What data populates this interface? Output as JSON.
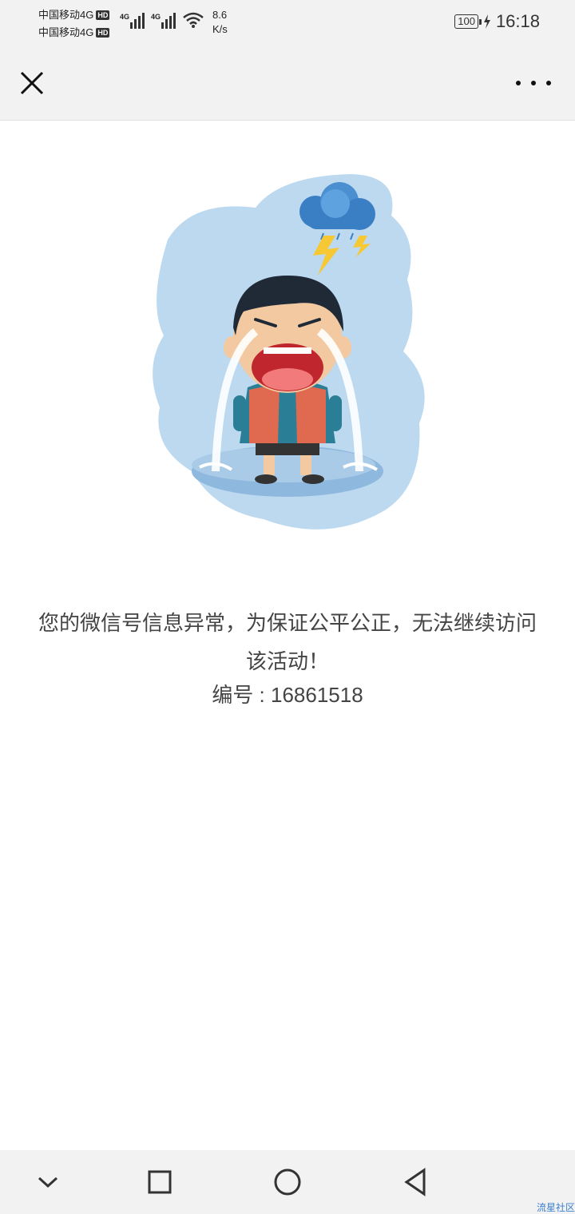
{
  "status_bar": {
    "carrier1": "中国移动4G",
    "carrier2": "中国移动4G",
    "hd_badge": "HD",
    "network1": "4G",
    "network2": "4G",
    "speed_value": "8.6",
    "speed_unit": "K/s",
    "battery": "100",
    "time": "16:18"
  },
  "header": {
    "close_icon": "close-icon",
    "more_icon": "more-dots-icon"
  },
  "main": {
    "illustration": "crying-boy-with-rain-cloud",
    "message": "您的微信号信息异常，为保证公平公正，无法继续访问该活动！",
    "code_label": "编号",
    "code_separator": " : ",
    "code_value": "16861518"
  },
  "nav_bar": {
    "items": [
      "chevron-down-icon",
      "square-icon",
      "circle-icon",
      "triangle-back-icon"
    ]
  },
  "watermark": "流星社区",
  "colors": {
    "bar_bg": "#f2f2f2",
    "text": "#444444",
    "illustration_bg": "#bcd9f0"
  }
}
